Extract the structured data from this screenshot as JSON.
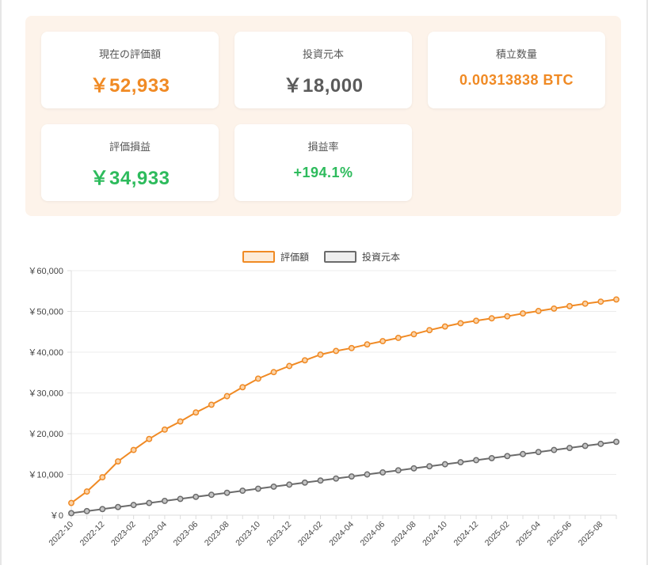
{
  "summary": {
    "current_value": {
      "label": "現在の評価額",
      "value": "￥52,933"
    },
    "principal": {
      "label": "投資元本",
      "value": "￥18,000"
    },
    "quantity": {
      "label": "積立数量",
      "value": "0.00313838 BTC"
    },
    "pnl": {
      "label": "評価損益",
      "value": "￥34,933"
    },
    "pnl_rate": {
      "label": "損益率",
      "value": "+194.1%"
    }
  },
  "colors": {
    "orange": "#f08a24",
    "gray": "#6b6b6b",
    "green": "#2dbb5c",
    "panel_bg": "#fdf3ea"
  },
  "chart_data": {
    "type": "line",
    "x": [
      "2022-10",
      "2022-11",
      "2022-12",
      "2023-01",
      "2023-02",
      "2023-03",
      "2023-04",
      "2023-05",
      "2023-06",
      "2023-07",
      "2023-08",
      "2023-09",
      "2023-10",
      "2023-11",
      "2023-12",
      "2024-01",
      "2024-02",
      "2024-03",
      "2024-04",
      "2024-05",
      "2024-06",
      "2024-07",
      "2024-08",
      "2024-09",
      "2024-10",
      "2024-11",
      "2024-12",
      "2025-01",
      "2025-02",
      "2025-03",
      "2025-04",
      "2025-05",
      "2025-06",
      "2025-07",
      "2025-08",
      "2025-09"
    ],
    "tick_labels": [
      "2022-10",
      "2022-12",
      "2023-02",
      "2023-04",
      "2023-06",
      "2023-08",
      "2023-10",
      "2023-12",
      "2024-02",
      "2024-04",
      "2024-06",
      "2024-08",
      "2024-10",
      "2024-12",
      "2025-02",
      "2025-04",
      "2025-06",
      "2025-08"
    ],
    "series": [
      {
        "name": "評価額",
        "color": "#f08a24",
        "values": [
          3000,
          5800,
          9300,
          13200,
          16000,
          18700,
          21000,
          23000,
          25200,
          27100,
          29200,
          31400,
          33500,
          35100,
          36600,
          38000,
          39400,
          40300,
          41000,
          41900,
          42700,
          43500,
          44400,
          45400,
          46300,
          47100,
          47700,
          48300,
          48800,
          49500,
          50100,
          50700,
          51300,
          51900,
          52400,
          52933
        ]
      },
      {
        "name": "投資元本",
        "color": "#6b6b6b",
        "values": [
          500,
          1000,
          1500,
          2000,
          2500,
          3000,
          3500,
          4000,
          4500,
          5000,
          5500,
          6000,
          6500,
          7000,
          7500,
          8000,
          8500,
          9000,
          9500,
          10000,
          10500,
          11000,
          11500,
          12000,
          12500,
          13000,
          13500,
          14000,
          14500,
          15000,
          15500,
          16000,
          16500,
          17000,
          17500,
          18000
        ]
      }
    ],
    "ylim": [
      0,
      60000
    ],
    "yticks": [
      "￥0",
      "￥10,000",
      "￥20,000",
      "￥30,000",
      "￥40,000",
      "￥50,000",
      "￥60,000"
    ],
    "ytick_values": [
      0,
      10000,
      20000,
      30000,
      40000,
      50000,
      60000
    ],
    "legend_position": "top",
    "grid": true
  }
}
